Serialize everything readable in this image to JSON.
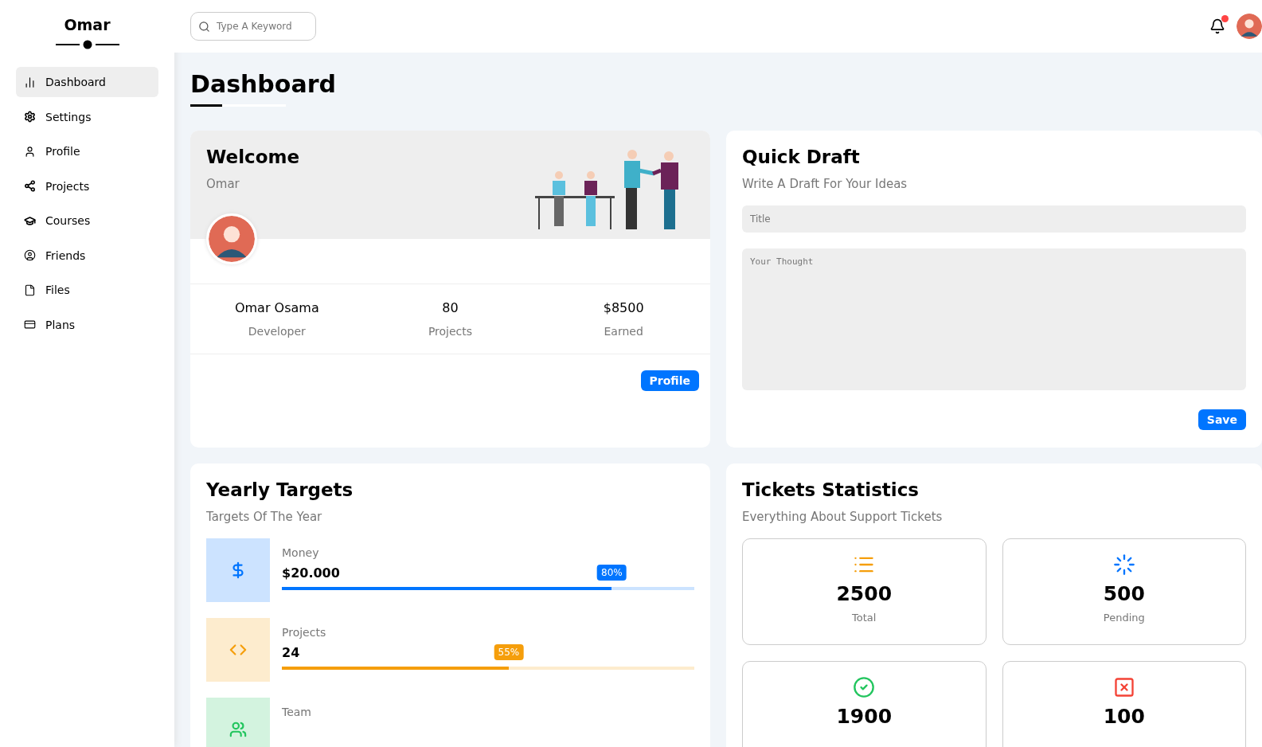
{
  "sidebar": {
    "title": "Omar",
    "items": [
      {
        "kind": "dashboard",
        "label": "Dashboard",
        "selected": true
      },
      {
        "kind": "settings",
        "label": "Settings",
        "selected": false
      },
      {
        "kind": "profile",
        "label": "Profile",
        "selected": false
      },
      {
        "kind": "projects",
        "label": "Projects",
        "selected": false
      },
      {
        "kind": "courses",
        "label": "Courses",
        "selected": false
      },
      {
        "kind": "friends",
        "label": "Friends",
        "selected": false
      },
      {
        "kind": "files",
        "label": "Files",
        "selected": false
      },
      {
        "kind": "plans",
        "label": "Plans",
        "selected": false
      }
    ]
  },
  "header": {
    "search": {
      "placeholder": "Type A Keyword"
    },
    "notifications": {
      "unread": true
    }
  },
  "page_title": "Dashboard",
  "welcome": {
    "title": "Welcome",
    "name": "Omar",
    "stats": [
      {
        "value": "Omar Osama",
        "label": "Developer"
      },
      {
        "value": "80",
        "label": "Projects"
      },
      {
        "value": "$8500",
        "label": "Earned"
      }
    ],
    "button": "Profile"
  },
  "quick_draft": {
    "title": "Quick Draft",
    "subtitle": "Write A Draft For Your Ideas",
    "title_field": {
      "placeholder": "Title"
    },
    "thought_field": {
      "placeholder": "Your Thought"
    },
    "button": "Save"
  },
  "yearly_targets": {
    "title": "Yearly Targets",
    "subtitle": "Targets Of The Year",
    "targets": [
      {
        "kind": "money",
        "label": "Money",
        "value": "$20.000",
        "level": 0.8,
        "reading": "80%",
        "color": "#0075ff"
      },
      {
        "kind": "code",
        "label": "Projects",
        "value": "24",
        "level": 0.55,
        "reading": "55%",
        "color": "#f59e0b"
      },
      {
        "kind": "team",
        "label": "Team",
        "color": "#22c55e"
      }
    ]
  },
  "tickets": {
    "title": "Tickets Statistics",
    "subtitle": "Everything About Support Tickets",
    "items": [
      {
        "kind": "total",
        "value": "2500",
        "label": "Total"
      },
      {
        "kind": "pending",
        "value": "500",
        "label": "Pending"
      },
      {
        "kind": "closed",
        "value": "1900"
      },
      {
        "kind": "deleted",
        "value": "100"
      }
    ]
  }
}
